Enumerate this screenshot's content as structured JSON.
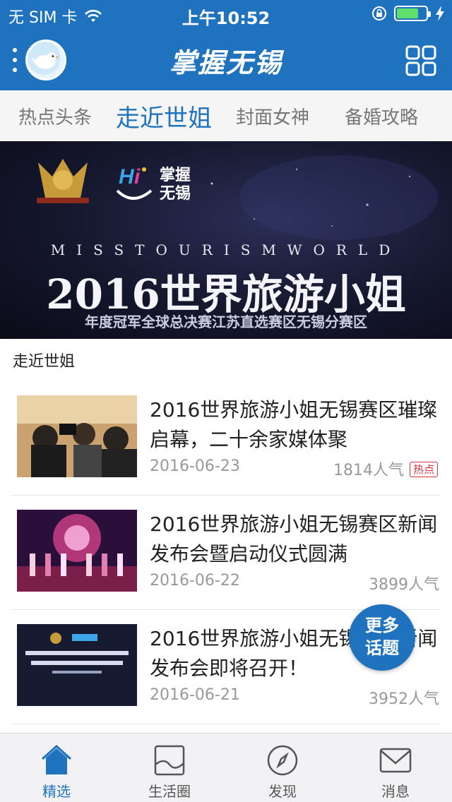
{
  "status_bar": {
    "carrier": "无 SIM 卡",
    "time": "上午10:52"
  },
  "header": {
    "title": "掌握无锡",
    "menu_icon": "more-vertical-icon",
    "avatar_icon": "bird-avatar-icon",
    "grid_icon": "grid-icon",
    "background_color": "#1f73be"
  },
  "tabs": [
    {
      "label": "热点头条",
      "active": false
    },
    {
      "label": "走近世姐",
      "active": true
    },
    {
      "label": "封面女神",
      "active": false
    },
    {
      "label": "备婚攻略",
      "active": false
    }
  ],
  "banner": {
    "subtitle": "MISSTOURISMWORLD",
    "title": "2016世界旅游小姐",
    "caption": "年度冠军全球总决赛江苏直选赛区无锡分赛区",
    "logo_text": "掌握无锡"
  },
  "section": {
    "label": "走近世姐"
  },
  "news": [
    {
      "title": "2016世界旅游小姐无锡赛区璀璨启幕，二十余家媒体聚",
      "date": "2016-06-23",
      "popularity": "1814人气",
      "badge": "热点"
    },
    {
      "title": "2016世界旅游小姐无锡赛区新闻发布会暨启动仪式圆满",
      "date": "2016-06-22",
      "popularity": "3899人气",
      "badge": ""
    },
    {
      "title": "2016世界旅游小姐无锡赛区新闻发布会即将召开！",
      "date": "2016-06-21",
      "popularity": "3952人气",
      "badge": ""
    }
  ],
  "floating_button": {
    "label_line1": "更多",
    "label_line2": "话题"
  },
  "bottom_nav": [
    {
      "label": "精选",
      "icon": "home-icon",
      "active": true
    },
    {
      "label": "生活圈",
      "icon": "image-icon",
      "active": false
    },
    {
      "label": "发现",
      "icon": "compass-icon",
      "active": false
    },
    {
      "label": "消息",
      "icon": "mail-icon",
      "active": false
    }
  ],
  "colors": {
    "accent": "#1f73be",
    "hot_badge": "#d9313a"
  }
}
